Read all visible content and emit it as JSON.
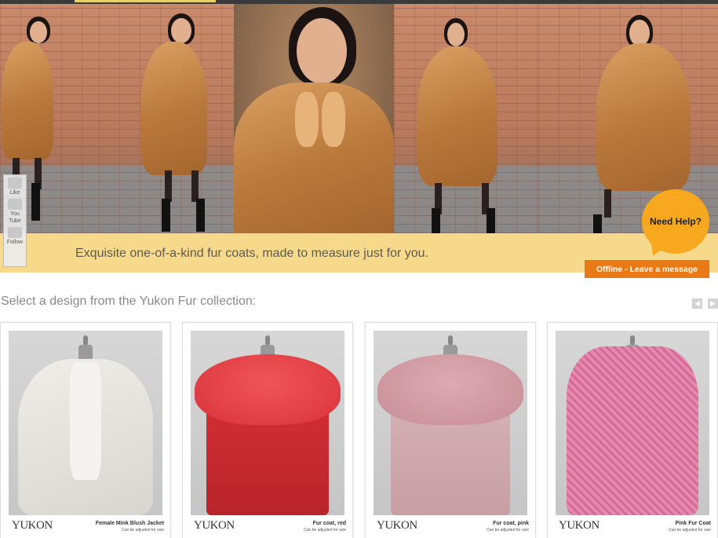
{
  "social": {
    "like_label": "Like",
    "youtube_label": "You",
    "youtube_sub": "Tube",
    "twitter_label": "Follow"
  },
  "banner": {
    "tagline": "Exquisite one-of-a-kind fur coats, made to measure just for you."
  },
  "chat": {
    "help_label": "Need Help?",
    "offline_label": "Offline - Leave a message"
  },
  "collection": {
    "heading": "Select a design from the Yukon Fur collection:",
    "items": [
      {
        "brand": "YUKON",
        "name": "Female Mink Blush Jacket",
        "note": "Can be adjusted for size",
        "color": "#e8e6e1"
      },
      {
        "brand": "YUKON",
        "name": "Fur coat, red",
        "note": "Can be adjusted for size",
        "color": "#e03a3e"
      },
      {
        "brand": "YUKON",
        "name": "Fur coat, pink",
        "note": "Can be adjusted for size",
        "color": "#d7a7ae"
      },
      {
        "brand": "YUKON",
        "name": "Pink Fur Coat",
        "note": "Can be adjusted for size",
        "color": "#e07aa4"
      }
    ]
  },
  "colors": {
    "band": "#f6d98b",
    "help_bubble": "#f7a81e",
    "offline_button": "#ea7a16"
  }
}
